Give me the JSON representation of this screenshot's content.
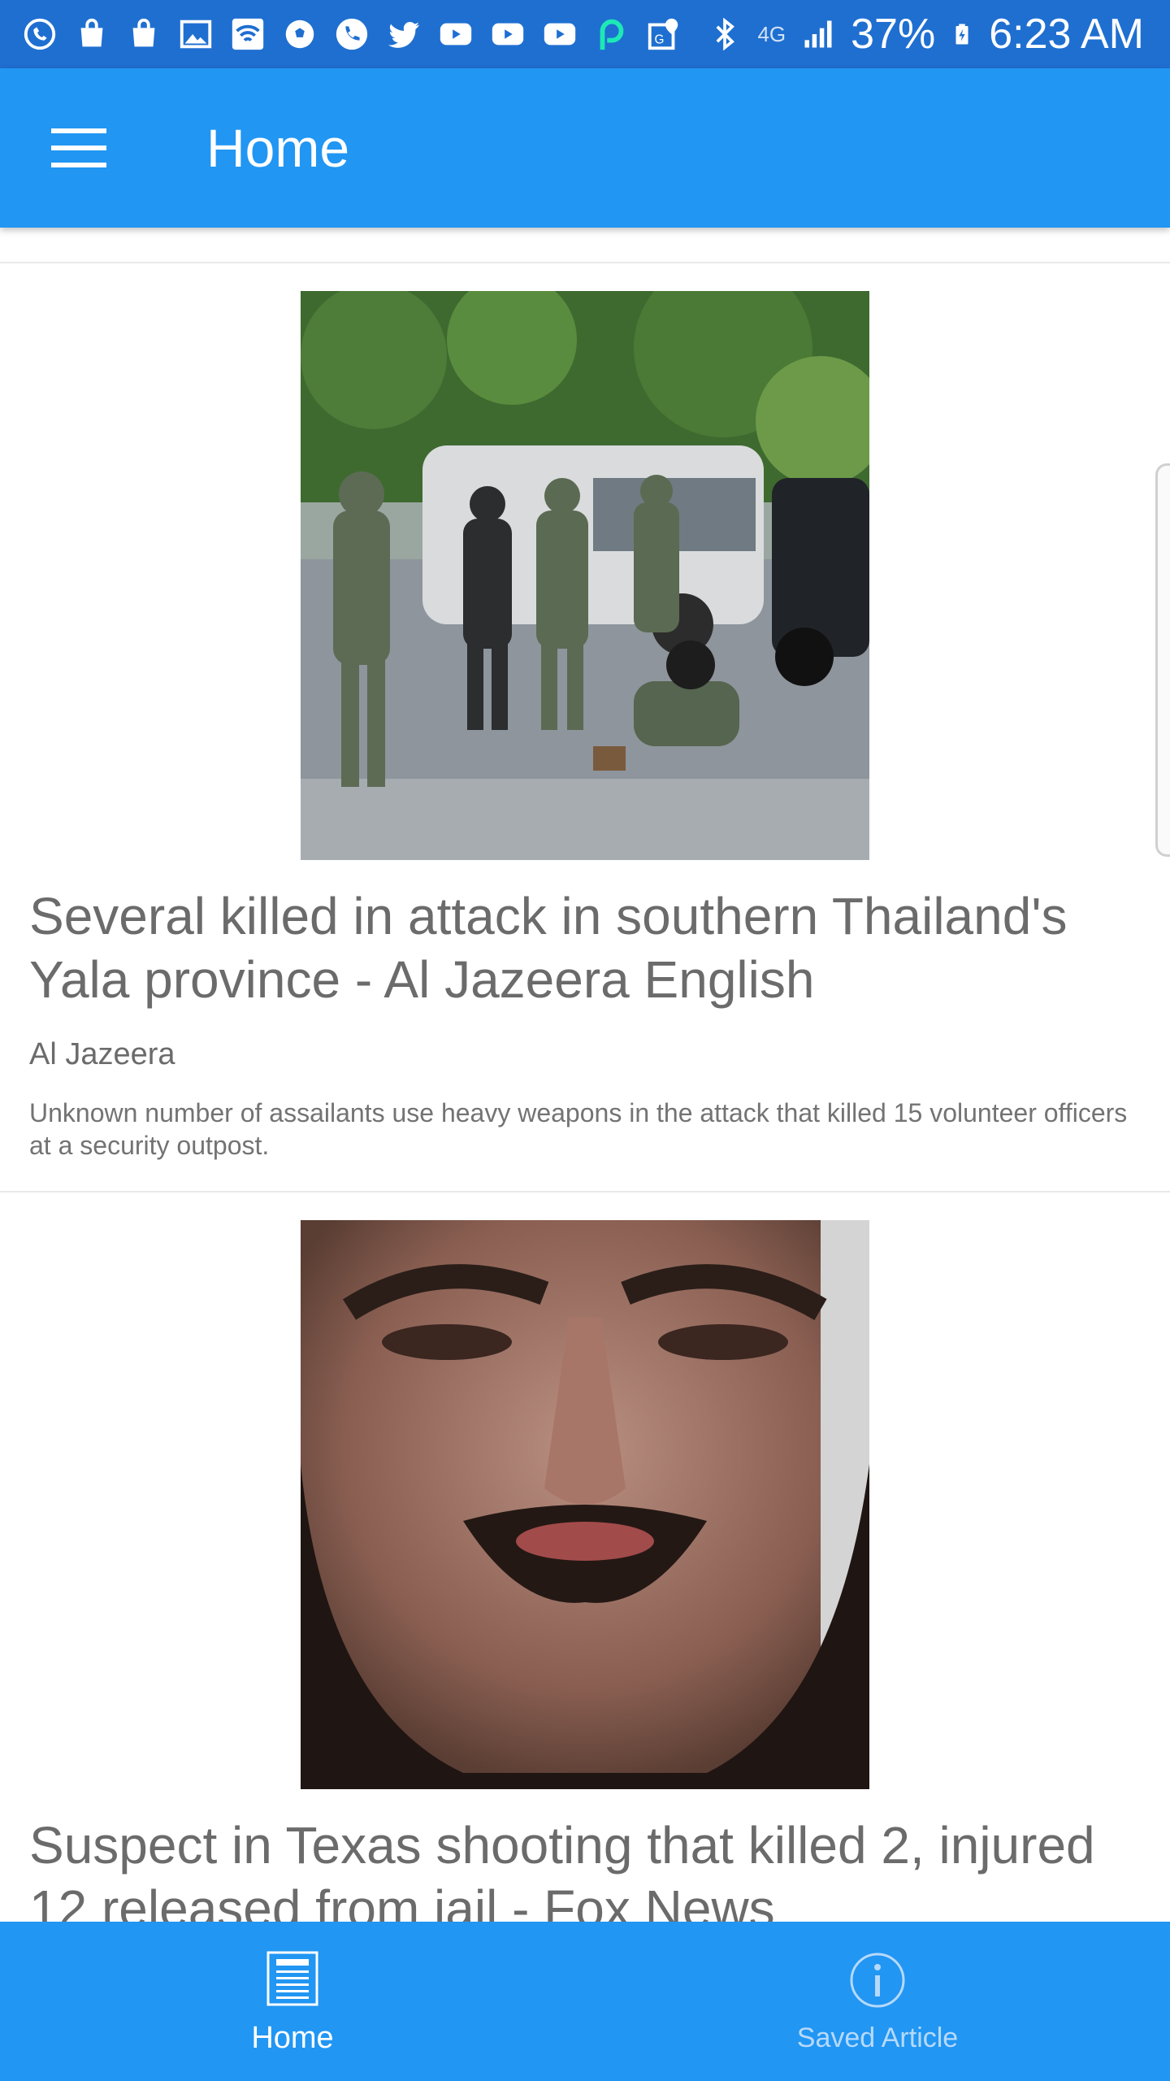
{
  "status_bar": {
    "battery": "37%",
    "time": "6:23 AM",
    "network": "4G",
    "icons": [
      "whatsapp-icon",
      "shopping-bag-icon",
      "shopping-bag-icon",
      "image-icon",
      "wifi-icon",
      "soccer-ball-icon",
      "phone-icon",
      "twitter-icon",
      "youtube-icon",
      "youtube-icon",
      "youtube-icon",
      "p-app-icon",
      "maps-icon",
      "bluetooth-icon",
      "signal-icon",
      "battery-charging-icon"
    ]
  },
  "app_bar": {
    "title": "Home",
    "menu_icon": "hamburger-menu-icon"
  },
  "articles": [
    {
      "title": "Several killed in attack in southern Thailand's Yala province - Al Jazeera English",
      "source": "Al Jazeera",
      "description": "Unknown number of assailants use heavy weapons in the attack that killed 15 volunteer officers at a security outpost."
    },
    {
      "title": "Suspect in Texas shooting that killed 2, injured 12 released from jail - Fox News",
      "source": "",
      "description": ""
    }
  ],
  "bottom_nav": {
    "items": [
      {
        "label": "Home",
        "icon": "newspaper-icon",
        "active": true
      },
      {
        "label": "Saved Article",
        "icon": "info-icon",
        "active": false
      }
    ]
  },
  "colors": {
    "status_bar": "#1f6fd1",
    "primary": "#2196f3",
    "text_gray": "#6b6b6b",
    "inactive_nav": "#b6d9fb"
  }
}
